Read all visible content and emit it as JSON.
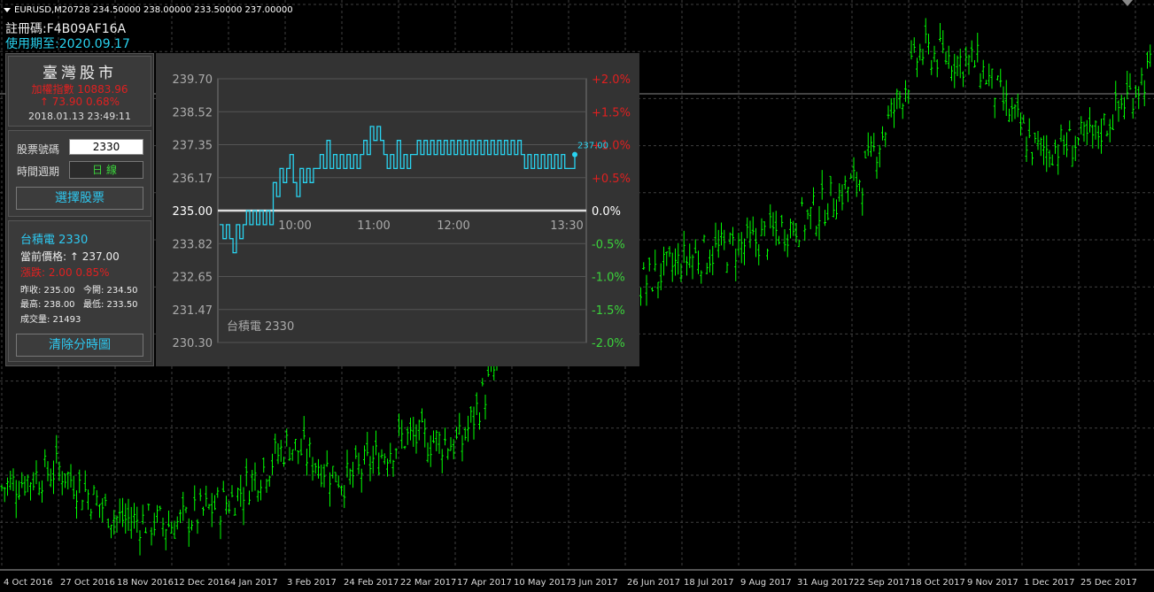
{
  "header": {
    "symbol_line": "EURUSD,M20728  234.50000 238.00000 233.50000 237.00000",
    "registration": "註冊碼:F4B09AF16A",
    "expiry": "使用期至:2020.09.17"
  },
  "panel": {
    "title": "臺灣股市",
    "index_line": "加權指數  10883.96",
    "index_change": "↑ 73.90  0.68%",
    "datetime": "2018.01.13 23:49:11",
    "stock_code_label": "股票號碼",
    "stock_code_value": "2330",
    "period_label": "時間週期",
    "period_value": "日線",
    "select_button": "選擇股票",
    "stock_name": "台積電 2330",
    "current_price": "當前價格: ↑ 237.00",
    "change": "漲跌: 2.00  0.85%",
    "prev_close": "昨收: 235.00",
    "open": "今開: 234.50",
    "high": "最高: 238.00",
    "low": "最低: 233.50",
    "volume": "成交量: 21493",
    "clear_button": "清除分時圖"
  },
  "colors": {
    "bull": "#00ff00",
    "bear": "#00ff00",
    "grid": "#404040",
    "intraday_line": "#29d3f0",
    "red": "#e02020",
    "green_pct": "#3bd43b"
  },
  "main_chart": {
    "x_labels": [
      "4 Oct 2016",
      "27 Oct 2016",
      "18 Nov 2016",
      "12 Dec 2016",
      "4 Jan 2017",
      "3 Feb 2017",
      "24 Feb 2017",
      "22 Mar 2017",
      "17 Apr 2017",
      "10 May 2017",
      "3 Jun 2017",
      "26 Jun 2017",
      "18 Jul 2017",
      "9 Aug 2017",
      "31 Aug 2017",
      "22 Sep 2017",
      "18 Oct 2017",
      "9 Nov 2017",
      "1 Dec 2017",
      "25 Dec 2017"
    ],
    "anchor_prices": [
      178,
      181,
      173,
      172,
      176,
      185,
      179,
      186,
      185,
      205,
      208,
      210,
      215,
      217,
      221,
      228,
      248,
      246,
      232,
      234,
      245
    ]
  },
  "chart_data": {
    "type": "line",
    "title": "台積電 2330",
    "y_ticks": [
      "239.70",
      "238.52",
      "237.35",
      "236.17",
      "235.00",
      "233.82",
      "232.65",
      "231.47",
      "230.30"
    ],
    "pct_ticks": [
      "+2.0%",
      "+1.5%",
      "+1.0%",
      "+0.5%",
      "0.0%",
      "-0.5%",
      "-1.0%",
      "-1.5%",
      "-2.0%"
    ],
    "x_ticks": [
      "10:00",
      "11:00",
      "12:00",
      "13:30"
    ],
    "ylim": [
      230.3,
      239.7
    ],
    "base_price": 235.0,
    "last_label": "237.00",
    "series": [
      {
        "values": [
          234.5,
          234.0,
          234.5,
          234.0,
          233.5,
          234.5,
          234.0,
          234.5,
          235.0,
          234.5,
          235.0,
          234.5,
          235.0,
          234.5,
          235.0,
          234.5,
          236.0,
          235.5,
          236.5,
          236.0,
          236.5,
          237.0,
          236.0,
          235.5,
          236.5,
          236.0,
          236.5,
          236.0,
          236.5,
          236.5,
          237.0,
          236.5,
          237.5,
          236.5,
          237.0,
          236.5,
          237.0,
          236.5,
          237.0,
          236.5,
          237.0,
          236.5,
          237.0,
          237.5,
          237.0,
          238.0,
          237.5,
          238.0,
          237.5,
          237.0,
          236.5,
          237.0,
          236.5,
          237.5,
          236.5,
          237.0,
          236.5,
          237.0,
          237.0,
          237.5,
          237.0,
          237.5,
          237.0,
          237.5,
          237.0,
          237.5,
          237.0,
          237.5,
          237.0,
          237.5,
          237.0,
          237.5,
          237.0,
          237.5,
          237.0,
          237.5,
          237.0,
          237.5,
          237.0,
          237.5,
          237.0,
          237.5,
          237.0,
          237.5,
          237.0,
          237.5,
          237.0,
          237.5,
          237.0,
          237.5,
          237.0,
          236.5,
          237.0,
          236.5,
          237.0,
          236.5,
          237.0,
          236.5,
          237.0,
          236.5,
          237.0,
          236.5,
          237.0,
          236.5,
          236.5,
          236.5,
          237.0
        ]
      }
    ]
  }
}
